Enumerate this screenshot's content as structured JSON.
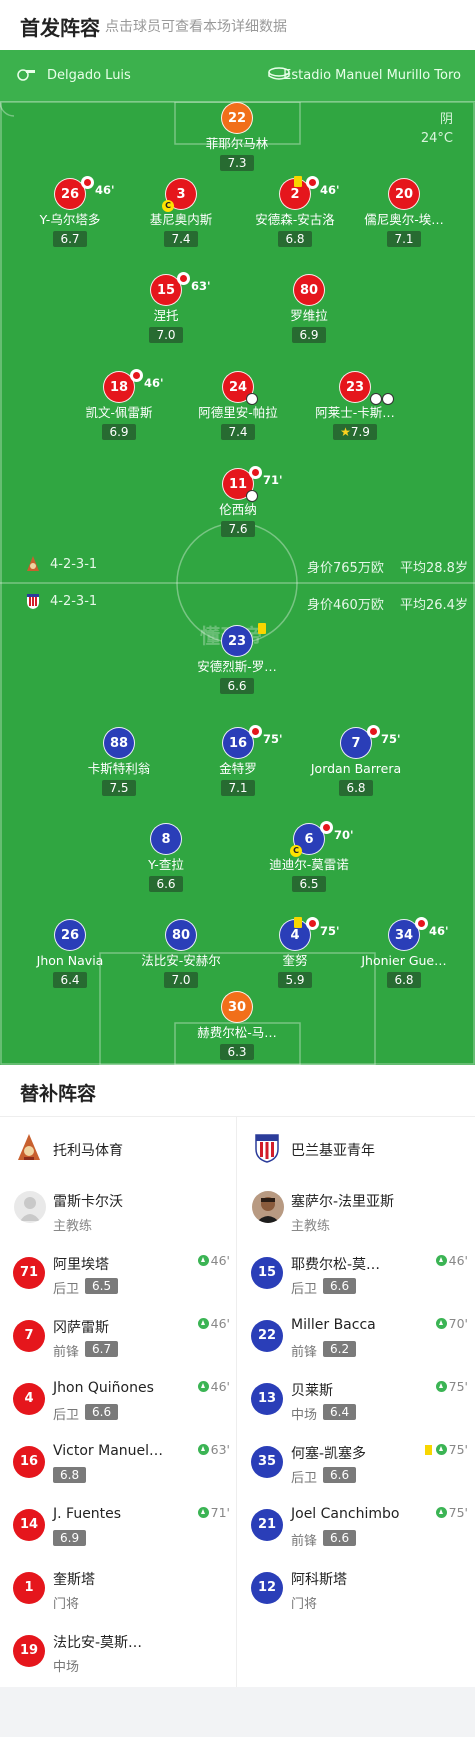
{
  "header": {
    "title": "首发阵容",
    "subtitle": "点击球员可查看本场详细数据"
  },
  "pitch_info": {
    "referee": "Delgado Luis",
    "venue": "Estadio Manuel Murillo Toro",
    "weather": "阴",
    "temperature": "24°C",
    "watermark": "懂球帝"
  },
  "home_team": {
    "formation": "4-2-3-1",
    "value": "身价765万欧",
    "avg_age": "平均28.8岁",
    "players": [
      {
        "num": "22",
        "name": "菲耶尔马林",
        "rating": "7.3",
        "color": "orange"
      },
      {
        "num": "26",
        "name": "Y-乌尔塔多",
        "rating": "6.7",
        "sub": "46'",
        "color": "red"
      },
      {
        "num": "3",
        "name": "基尼奥内斯",
        "rating": "7.4",
        "captain": "C",
        "color": "red"
      },
      {
        "num": "2",
        "name": "安德森-安古洛",
        "rating": "6.8",
        "sub": "46'",
        "yellow": true,
        "color": "red"
      },
      {
        "num": "20",
        "name": "儒尼奥尔-埃…",
        "rating": "7.1",
        "color": "red"
      },
      {
        "num": "15",
        "name": "涅托",
        "rating": "7.0",
        "sub": "63'",
        "color": "red"
      },
      {
        "num": "80",
        "name": "罗维拉",
        "rating": "6.9",
        "color": "red"
      },
      {
        "num": "18",
        "name": "凯文-佩雷斯",
        "rating": "6.9",
        "sub": "46'",
        "color": "red"
      },
      {
        "num": "24",
        "name": "阿德里安-帕拉",
        "rating": "7.4",
        "goal": true,
        "color": "red"
      },
      {
        "num": "23",
        "name": "阿莱士-卡斯…",
        "rating": "7.9",
        "star": true,
        "color": "red"
      },
      {
        "num": "11",
        "name": "伦西纳",
        "rating": "7.6",
        "sub": "71'",
        "goal": true,
        "color": "red"
      }
    ]
  },
  "away_team": {
    "formation": "4-2-3-1",
    "value": "身价460万欧",
    "avg_age": "平均26.4岁",
    "players": [
      {
        "num": "23",
        "name": "安德烈斯-罗…",
        "rating": "6.6",
        "yellow": true,
        "color": "blue"
      },
      {
        "num": "88",
        "name": "卡斯特利翁",
        "rating": "7.5",
        "color": "blue"
      },
      {
        "num": "16",
        "name": "金特罗",
        "rating": "7.1",
        "sub": "75'",
        "color": "blue"
      },
      {
        "num": "7",
        "name": "Jordan Barrera",
        "rating": "6.8",
        "sub": "75'",
        "color": "blue"
      },
      {
        "num": "8",
        "name": "Y-查拉",
        "rating": "6.6",
        "color": "blue"
      },
      {
        "num": "6",
        "name": "迪迪尔-莫雷诺",
        "rating": "6.5",
        "sub": "70'",
        "captain": "C",
        "color": "blue"
      },
      {
        "num": "26",
        "name": "Jhon Navia",
        "rating": "6.4",
        "color": "blue"
      },
      {
        "num": "80",
        "name": "法比安-安赫尔",
        "rating": "7.0",
        "color": "blue"
      },
      {
        "num": "4",
        "name": "奎努",
        "rating": "5.9",
        "sub": "75'",
        "yellow": true,
        "color": "blue"
      },
      {
        "num": "34",
        "name": "Jhonier Gue…",
        "rating": "6.8",
        "sub": "46'",
        "color": "blue"
      },
      {
        "num": "30",
        "name": "赫费尔松-马…",
        "rating": "6.3",
        "color": "orange"
      }
    ]
  },
  "subs": {
    "title": "替补阵容",
    "left": {
      "team": "托利马体育",
      "coach": {
        "name": "雷斯卡尔沃",
        "role": "主教练"
      },
      "players": [
        {
          "num": "71",
          "name": "阿里埃塔",
          "pos": "后卫",
          "rating": "6.5",
          "in": "46'"
        },
        {
          "num": "7",
          "name": "冈萨雷斯",
          "pos": "前锋",
          "rating": "6.7",
          "in": "46'"
        },
        {
          "num": "4",
          "name": "Jhon Quiñones",
          "pos": "后卫",
          "rating": "6.6",
          "in": "46'"
        },
        {
          "num": "16",
          "name": "Victor Manuel…",
          "pos": "",
          "rating": "6.8",
          "in": "63'"
        },
        {
          "num": "14",
          "name": "J. Fuentes",
          "pos": "",
          "rating": "6.9",
          "in": "71'"
        },
        {
          "num": "1",
          "name": "奎斯塔",
          "pos": "门将",
          "rating": "",
          "in": ""
        },
        {
          "num": "19",
          "name": "法比安-莫斯…",
          "pos": "中场",
          "rating": "",
          "in": ""
        }
      ]
    },
    "right": {
      "team": "巴兰基亚青年",
      "coach": {
        "name": "塞萨尔-法里亚斯",
        "role": "主教练"
      },
      "players": [
        {
          "num": "15",
          "name": "耶费尔松-莫…",
          "pos": "后卫",
          "rating": "6.6",
          "in": "46'"
        },
        {
          "num": "22",
          "name": "Miller Bacca",
          "pos": "前锋",
          "rating": "6.2",
          "in": "70'"
        },
        {
          "num": "13",
          "name": "贝莱斯",
          "pos": "中场",
          "rating": "6.4",
          "in": "75'"
        },
        {
          "num": "35",
          "name": "何塞-凯塞多",
          "pos": "后卫",
          "rating": "6.6",
          "in": "75'",
          "yellow": true
        },
        {
          "num": "21",
          "name": "Joel Canchimbo",
          "pos": "前锋",
          "rating": "6.6",
          "in": "75'"
        },
        {
          "num": "12",
          "name": "阿科斯塔",
          "pos": "门将",
          "rating": "",
          "in": ""
        }
      ]
    }
  },
  "colors": {
    "pitch": "#30a641",
    "home": "#e5161c",
    "away": "#2a3eb8",
    "keeper": "#f16f1a"
  }
}
